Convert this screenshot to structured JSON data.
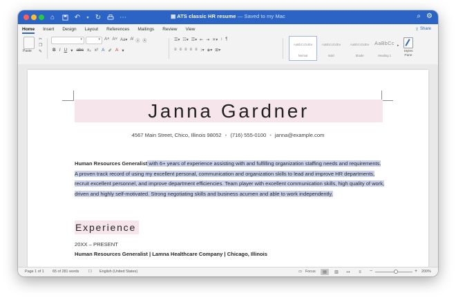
{
  "window": {
    "title": "ATS classic HR resume",
    "saved_status": "— Saved to my Mac",
    "share_label": "Share"
  },
  "tabs": [
    {
      "label": "Home",
      "active": true
    },
    {
      "label": "Insert"
    },
    {
      "label": "Design"
    },
    {
      "label": "Layout"
    },
    {
      "label": "References"
    },
    {
      "label": "Mailings"
    },
    {
      "label": "Review"
    },
    {
      "label": "View"
    }
  ],
  "ribbon": {
    "paste_label": "Paste",
    "styles": [
      {
        "sample": "AaBbCcDdEe",
        "name": "Normal"
      },
      {
        "sample": "AaBbCcDdEe",
        "name": "Bold"
      },
      {
        "sample": "AaBbCcDdEe",
        "name": "Shade"
      },
      {
        "sample": "AaBbCc",
        "name": "Heading 1"
      }
    ],
    "styles_pane_label": "Styles Pane"
  },
  "document": {
    "name": "Janna Gardner",
    "contact": [
      "4567 Main Street, Chico, Illinois 98052",
      "(716) 555-0100",
      "janna@example.com"
    ],
    "summary_bold": "Human Resources Generalist",
    "summary_text": " with 6+ years of experience assisting with and fulfilling organization staffing needs and requirements. A proven track record of using my excellent personal, communication and organization skills to lead and improve HR departments, recruit excellent personnel, and improve department efficiencies. Team player with excellent communication skills, high quality of work, driven and highly self-motivated. Strong negotiating skills and business acumen and able to work independently.",
    "section_heading": "Experience",
    "job_dates": "20XX – PRESENT",
    "job_title": "Human Resources Generalist | Lamna Healthcare Company | Chicago, Illinois"
  },
  "statusbar": {
    "page": "Page 1 of 1",
    "words": "65 of 281 words",
    "language": "English (United States)",
    "focus": "Focus",
    "zoom": "200%"
  },
  "colors": {
    "titlebar": "#2b64c4",
    "name_band": "#f6e6eb",
    "selection": "#c9d1ea"
  }
}
